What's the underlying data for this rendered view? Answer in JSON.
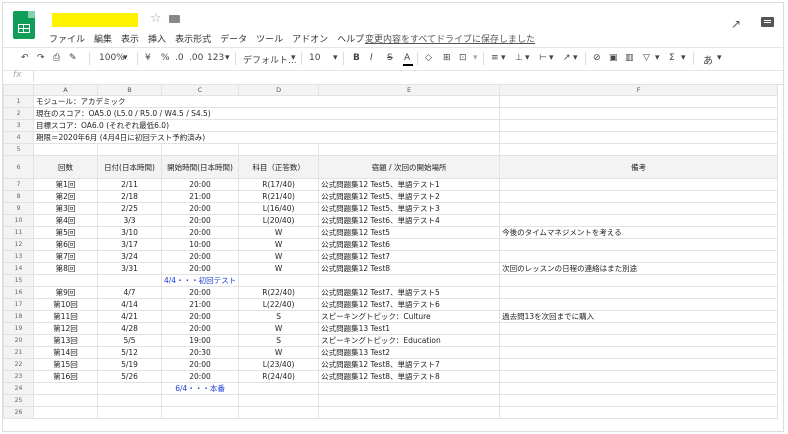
{
  "app": {
    "menu": [
      "ファイル",
      "編集",
      "表示",
      "挿入",
      "表示形式",
      "データ",
      "ツール",
      "アドオン",
      "ヘルプ"
    ],
    "save_status": "変更内容をすべてドライブに保存しました"
  },
  "toolbar": {
    "zoom": "100%",
    "currency": "¥",
    "percent": "%",
    "dec_less": ".0",
    "dec_more": ".00",
    "format_more": "123",
    "font": "デフォルト...",
    "font_size": "10",
    "bold": "B",
    "italic": "I",
    "strike": "S",
    "text_color": "A",
    "input_tools": "あ"
  },
  "formula_bar": {
    "fx": "fx"
  },
  "sheet": {
    "columns": [
      "A",
      "B",
      "C",
      "D",
      "E",
      "F"
    ],
    "info_rows": [
      "モジュール：アカデミック",
      "現在のスコア：OA5.0 (L5.0 / R5.0 / W4.5 / S4.5)",
      "目標スコア：OA6.0 (それぞれ最低6.0)",
      "期限＝2020年6月 (4月4日に初回テスト予約済み)"
    ],
    "headers": [
      "回数",
      "日付(日本時間)",
      "開始時間(日本時間)",
      "科目（正答数）",
      "宿題 / 次回の開始場所",
      "備考"
    ],
    "lessons_a": [
      [
        "第1回",
        "2/11",
        "20:00",
        "R(17/40)",
        "公式問題集12 Test5、単語テスト1",
        ""
      ],
      [
        "第2回",
        "2/18",
        "21:00",
        "R(21/40)",
        "公式問題集12 Test5、単語テスト2",
        ""
      ],
      [
        "第3回",
        "2/25",
        "20:00",
        "L(16/40)",
        "公式問題集12 Test5、単語テスト3",
        ""
      ],
      [
        "第4回",
        "3/3",
        "20:00",
        "L(20/40)",
        "公式問題集12 Test6、単語テスト4",
        ""
      ],
      [
        "第5回",
        "3/10",
        "20:00",
        "W",
        "公式問題集12 Test5",
        "今後のタイムマネジメントを考える"
      ],
      [
        "第6回",
        "3/17",
        "10:00",
        "W",
        "公式問題集12 Test6",
        ""
      ],
      [
        "第7回",
        "3/24",
        "20:00",
        "W",
        "公式問題集12 Test7",
        ""
      ],
      [
        "第8回",
        "3/31",
        "20:00",
        "W",
        "公式問題集12 Test8",
        "次回のレッスンの日程の連絡はまた別途"
      ]
    ],
    "milestone_1": "4/4・・・初回テスト",
    "lessons_b": [
      [
        "第9回",
        "4/7",
        "20:00",
        "R(22/40)",
        "公式問題集12 Test7、単語テスト5",
        ""
      ],
      [
        "第10回",
        "4/14",
        "21:00",
        "L(22/40)",
        "公式問題集12 Test7、単語テスト6",
        ""
      ],
      [
        "第11回",
        "4/21",
        "20:00",
        "S",
        "スピーキングトピック：Culture",
        "過去問13を次回までに購入"
      ],
      [
        "第12回",
        "4/28",
        "20:00",
        "W",
        "公式問題集13 Test1",
        ""
      ],
      [
        "第13回",
        "5/5",
        "19:00",
        "S",
        "スピーキングトピック：Education",
        ""
      ],
      [
        "第14回",
        "5/12",
        "20:30",
        "W",
        "公式問題集13 Test2",
        ""
      ],
      [
        "第15回",
        "5/19",
        "20:00",
        "L(23/40)",
        "公式問題集12 Test8、単語テスト7",
        ""
      ],
      [
        "第16回",
        "5/26",
        "20:00",
        "R(24/40)",
        "公式問題集12 Test8、単語テスト8",
        ""
      ]
    ],
    "milestone_2": "6/4・・・本番"
  }
}
